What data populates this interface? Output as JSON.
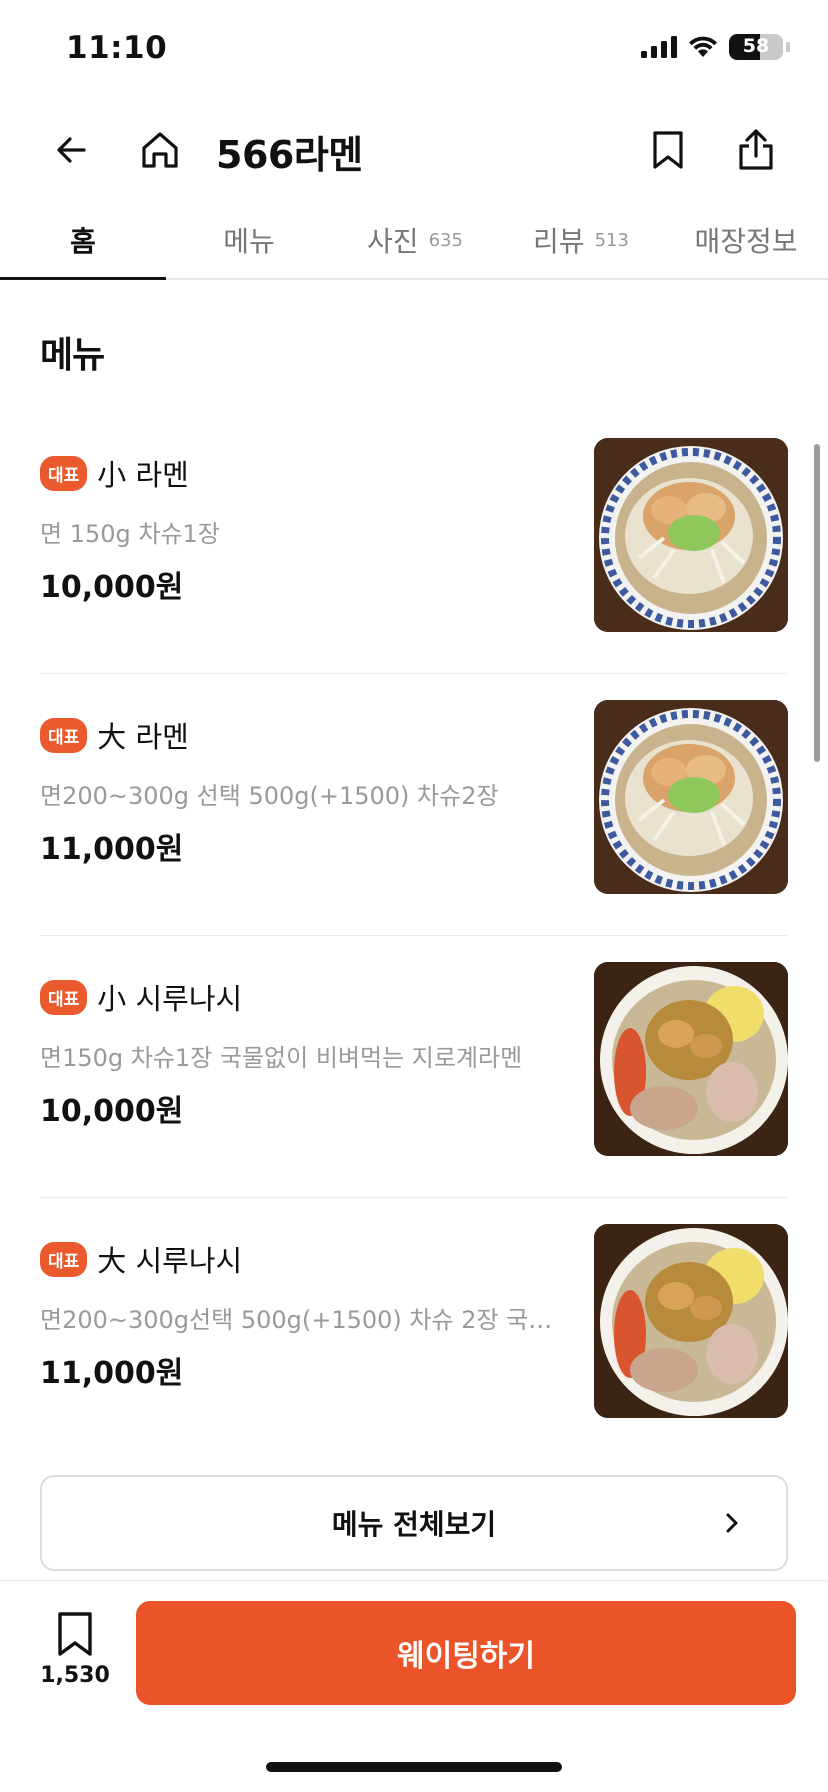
{
  "status_bar": {
    "time": "11:10",
    "battery": "58",
    "battery_level": 0.58
  },
  "header": {
    "title": "566라멘"
  },
  "tabs": [
    {
      "label": "홈",
      "count": ""
    },
    {
      "label": "메뉴",
      "count": ""
    },
    {
      "label": "사진",
      "count": "635"
    },
    {
      "label": "리뷰",
      "count": "513"
    },
    {
      "label": "매장정보",
      "count": ""
    }
  ],
  "section": {
    "title": "메뉴"
  },
  "menu_items": [
    {
      "badge": "대표",
      "name": "小 라멘",
      "desc": "면 150g 차슈1장",
      "price": "10,000원",
      "image": "ramen-bowl"
    },
    {
      "badge": "대표",
      "name": "大 라멘",
      "desc": "면200~300g 선택 500g(+1500) 차슈2장",
      "price": "11,000원",
      "image": "ramen-bowl"
    },
    {
      "badge": "대표",
      "name": "小 시루나시",
      "desc": "면150g 차슈1장 국물없이 비벼먹는 지로계라멘",
      "price": "10,000원",
      "image": "shirunashi-plate"
    },
    {
      "badge": "대표",
      "name": "大 시루나시",
      "desc": "면200~300g선택 500g(+1500) 차슈 2장 국물...",
      "price": "11,000원",
      "image": "shirunashi-plate"
    }
  ],
  "view_all": {
    "label": "메뉴 전체보기"
  },
  "bottom_bar": {
    "save_count": "1,530",
    "waiting_label": "웨이팅하기"
  },
  "colors": {
    "accent": "#ea5428",
    "badge": "#ea5a2c",
    "muted_text": "#9a9a9a"
  }
}
